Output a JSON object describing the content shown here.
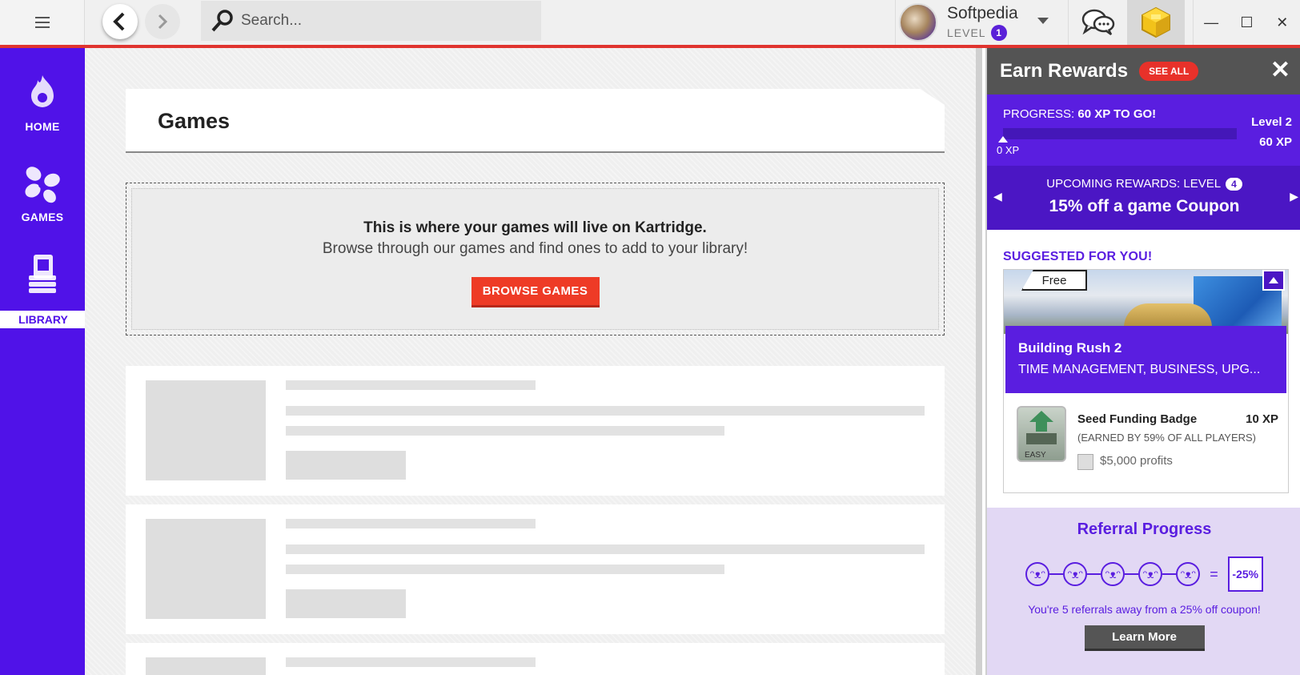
{
  "titlebar": {
    "search_placeholder": "Search...",
    "user_name": "Softpedia",
    "level_label": "LEVEL",
    "level_value": "1",
    "window_minimize": "—",
    "window_maximize": "☐",
    "window_close": "✕"
  },
  "sidebar": {
    "items": [
      {
        "label": "HOME",
        "icon": "home-icon"
      },
      {
        "label": "GAMES",
        "icon": "games-icon"
      },
      {
        "label": "LIBRARY",
        "icon": "library-icon"
      }
    ]
  },
  "main": {
    "title": "Games",
    "empty_title": "This is where your games will live on Kartridge.",
    "empty_subtitle": "Browse through our games and find ones to add to your library!",
    "browse_button": "BROWSE GAMES"
  },
  "rewards": {
    "title": "Earn Rewards",
    "see_all": "SEE ALL",
    "close": "✕",
    "progress_prefix": "PROGRESS:",
    "progress_value": "60 XP TO GO!",
    "progress_fraction": 0,
    "progress_start": "0 XP",
    "next_level": "Level 2",
    "next_level_xp": "60 XP",
    "upcoming_label": "UPCOMING REWARDS: LEVEL",
    "upcoming_level": "4",
    "upcoming_reward": "15% off a game Coupon",
    "suggested_title": "SUGGESTED FOR YOU!",
    "game": {
      "price_tag": "Free",
      "name": "Building Rush 2",
      "genres": "TIME MANAGEMENT, BUSINESS, UPG..."
    },
    "achievement": {
      "name": "Seed Funding Badge",
      "xp": "10 XP",
      "earned": "(EARNED BY 59% OF ALL PLAYERS)",
      "difficulty": "EASY",
      "goal": "$5,000 profits"
    },
    "referral": {
      "title": "Referral Progress",
      "equals": "=",
      "coupon": "-25%",
      "message": "You're 5 referrals away from a 25% off coupon!",
      "learn_more": "Learn More"
    }
  },
  "colors": {
    "accent_purple": "#5012e8",
    "panel_purple": "#5a1ee0",
    "browse_red": "#ee3b26",
    "title_red_line": "#e0342f"
  }
}
